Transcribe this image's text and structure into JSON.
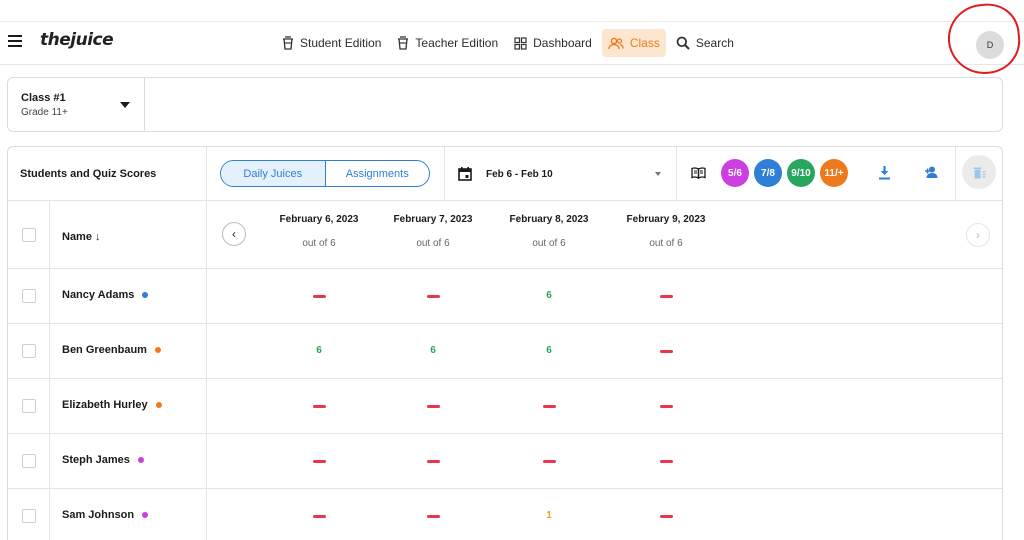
{
  "topbar": {
    "logo": "thejuice",
    "nav": [
      {
        "label": "Student Edition",
        "icon": "cup-icon"
      },
      {
        "label": "Teacher Edition",
        "icon": "cup-icon"
      },
      {
        "label": "Dashboard",
        "icon": "grid-icon"
      },
      {
        "label": "Class",
        "icon": "users-icon",
        "active": true
      },
      {
        "label": "Search",
        "icon": "search-icon"
      }
    ],
    "avatar": "D",
    "accent": "#ee7a1e"
  },
  "class_selector": {
    "name": "Class #1",
    "grade": "Grade 11+"
  },
  "table": {
    "title": "Students and Quiz Scores",
    "toggle": [
      "Daily Juices",
      "Assignments"
    ],
    "date_range": "Feb 6 - Feb 10",
    "grade_badges": [
      {
        "label": "5/6",
        "color": "#cc3ee0"
      },
      {
        "label": "7/8",
        "color": "#2f7fd6"
      },
      {
        "label": "9/10",
        "color": "#27a75e"
      },
      {
        "label": "11/+",
        "color": "#ef7a1d"
      }
    ],
    "name_header": "Name ↓",
    "dates": [
      {
        "date": "February 6, 2023",
        "out_of": "out of 6"
      },
      {
        "date": "February 7, 2023",
        "out_of": "out of 6"
      },
      {
        "date": "February 8, 2023",
        "out_of": "out of 6"
      },
      {
        "date": "February 9, 2023",
        "out_of": "out of 6"
      }
    ],
    "students": [
      {
        "name": "Nancy Adams",
        "dot_color": "#2f7fd6",
        "scores": [
          null,
          null,
          "6",
          null
        ]
      },
      {
        "name": "Ben Greenbaum",
        "dot_color": "#ef7a1d",
        "scores": [
          "6",
          "6",
          "6",
          null
        ]
      },
      {
        "name": "Elizabeth Hurley",
        "dot_color": "#ef7a1d",
        "scores": [
          null,
          null,
          null,
          null
        ]
      },
      {
        "name": "Steph James",
        "dot_color": "#cc3ee0",
        "scores": [
          null,
          null,
          null,
          null
        ]
      },
      {
        "name": "Sam Johnson",
        "dot_color": "#cc3ee0",
        "scores": [
          null,
          null,
          "1",
          null
        ]
      }
    ]
  }
}
